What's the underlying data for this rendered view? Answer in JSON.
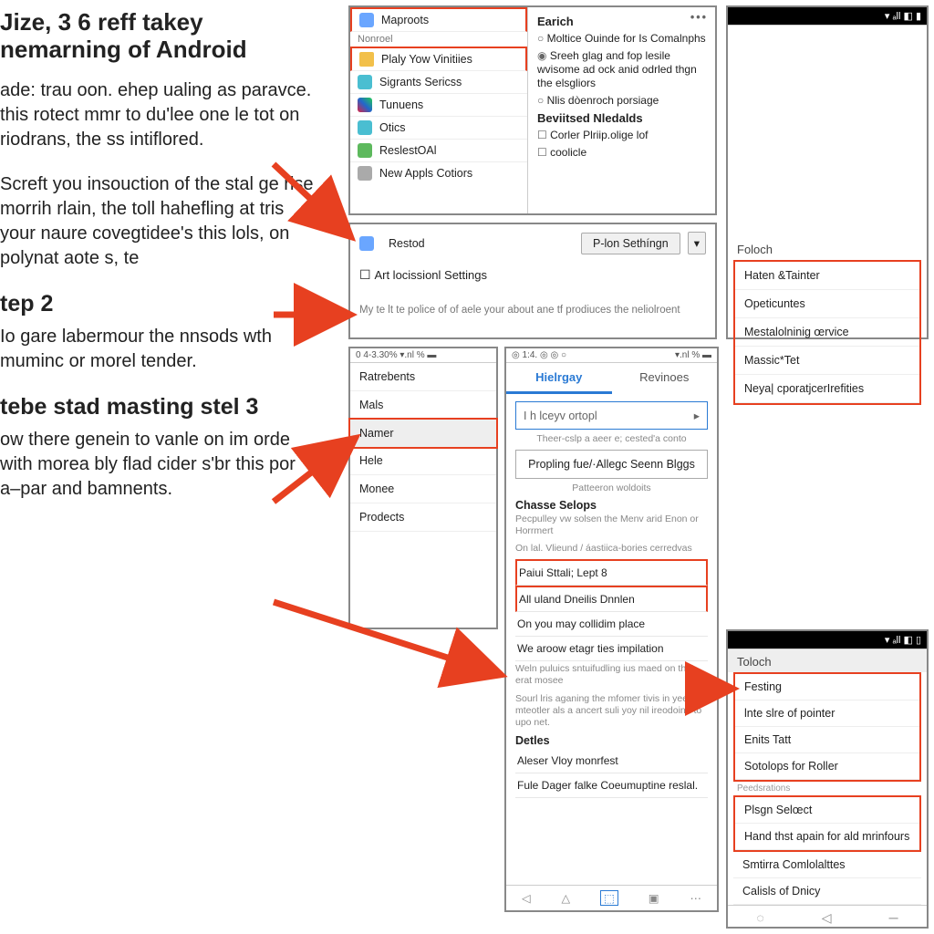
{
  "text": {
    "title_line1": "Jize, 3 6 reff takey",
    "title_line2": "nemarning of Android",
    "para1": "ade: trau oon. ehep ualing as paravce. this rotect mmr to du'lee one le tot on riodrans, the ss intiflored.",
    "para2": "Screft you insouction of the stal ge rise morrih rlain, the toll hahefling at tris your naure covegtidee's this lols, on polynat aote s, te",
    "step2_h": "tep 2",
    "step2_p": "Io gare labermour the nnsods wth muminc or morel tender.",
    "step3_h": "tebe stad masting stel 3",
    "step3_p": "ow there genein to vanle on im orde with morea bly flad cider s'br this por a–par and bamnents."
  },
  "panelA": {
    "menu_label": "Nonroel",
    "items": [
      "Maproots",
      "Plaly Yow Vinitiies",
      "Sigrants Sericss",
      "Tunuens",
      "Otics",
      "ReslestOAl",
      "New Appls Cotiors"
    ],
    "hl_indices": [
      0,
      1
    ],
    "right_title": "Earich",
    "radios": [
      "Moltice Ouinde for Is Comalnphs",
      "Sreeh glag and fop lesile wvisome ad ock anid odrled thgn the elsgliors",
      "Nlis dòenroch porsiage"
    ],
    "radio_selected": 1,
    "sub_title": "Beviitsed Nledalds",
    "checks": [
      "Corler Plriip.olige lof",
      "coolicle"
    ],
    "more_icon": "•••"
  },
  "panelB": {
    "label": "Restod",
    "button": "P-lon Sethíngn",
    "button_caret": "▾",
    "checkbox": "Art locissionl Settings",
    "footer": "My te lt te police of of aele your about ane tf prodiuces the neliolroent"
  },
  "panelC": {
    "status": "0 4-3.30%  ▾.nl %  ▬",
    "items": [
      "Ratrebents",
      "Mals",
      "Namer",
      "Hele",
      "Monee",
      "Prodects"
    ],
    "selected": 2
  },
  "panelD": {
    "status_left": "◎ 1:4. ◎ ◎ ○",
    "status_right": "▾.nl %  ▬",
    "tabs": [
      "Hielrgay",
      "Revinoes"
    ],
    "active_tab": 0,
    "select_placeholder": "I h lceyv ortopl",
    "select_caret": "▸",
    "caption1": "Theer-cslp a aeer e; cested'a conto",
    "big_button": "Propling fue/·Allegc Seenn Blggs",
    "caption2": "Patteeron woldoits",
    "section1": "Chasse Selops",
    "section1_desc": "Pecpulley vw solsen the Menv arid Enon or Horrmert",
    "caption3": "On lal. Vlieund / áastiica-bories cerredvas",
    "list1": [
      "Paiui Sttali;  Lept  8",
      "All  uland  Dneilis  Dnnlen",
      "On you may collidim place",
      "We aroow etagr ties impilation",
      "Weln puluics sntuifudling ius maed on that erat mosee",
      "Sourl lris aganing the mfomer tivis in yeelig is mteotler als a ancert suli yoy nil ireodoino to upo net."
    ],
    "list1_hl": [
      0,
      1
    ],
    "section2": "Detles",
    "list2": [
      "Aleser Vloy monrfest",
      "Fule Dager falke Coeumuptine reslal."
    ],
    "nav_icons": [
      "◁",
      "△",
      "⬚",
      "▣",
      "⋯"
    ]
  },
  "panelE": {
    "status": "▾ ₐll ◧ ▮",
    "title": "Foloch",
    "items": [
      "Haten &Tainter",
      "Opeticuntes",
      "Mestalolninig œrvice",
      "Massic*Tet",
      "Neya| cporatjcerIrefities"
    ]
  },
  "panelF": {
    "status": "▾ ₐll ◧ ▯",
    "title": "Toloch",
    "group1": [
      "Festing",
      "lnte slre of pointer",
      "Enits Tatt",
      "Sotolops for Roller"
    ],
    "group_sep": "Peedsrations",
    "group2": [
      "Plsgn Selœct",
      "Hand thst apain for ald mrinfours"
    ],
    "group3": [
      "Smtirra Comlolalttes",
      "Calisls of Dnicy"
    ],
    "nav_icons": [
      "◌",
      "◁",
      "─"
    ]
  }
}
